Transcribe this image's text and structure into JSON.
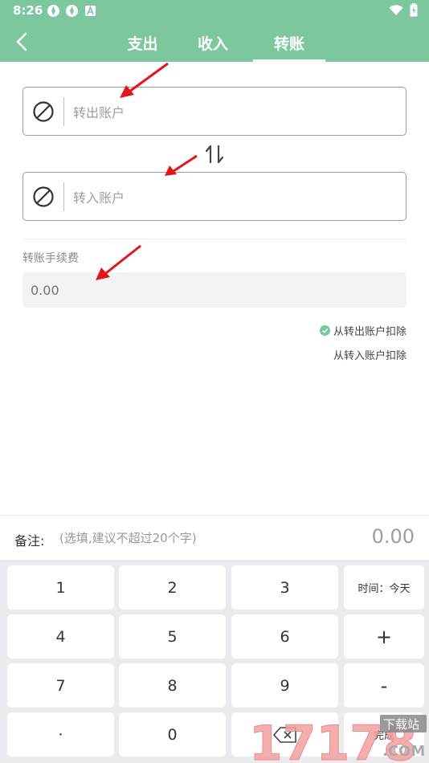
{
  "status": {
    "time": "8:26"
  },
  "header": {
    "tabs": [
      {
        "label": "支出"
      },
      {
        "label": "收入"
      },
      {
        "label": "转账",
        "active": true
      }
    ]
  },
  "transfer": {
    "out_placeholder": "转出账户",
    "in_placeholder": "转入账户",
    "fee_label": "转账手续费",
    "fee_placeholder": "0.00",
    "deduct_options": [
      {
        "label": "从转出账户扣除",
        "selected": true
      },
      {
        "label": "从转入账户扣除",
        "selected": false
      }
    ]
  },
  "note": {
    "label": "备注:",
    "placeholder": "(选填,建议不超过20个字)",
    "amount": "0.00"
  },
  "keypad": {
    "keys": [
      "1",
      "2",
      "3",
      "时间：今天",
      "4",
      "5",
      "6",
      "+",
      "7",
      "8",
      "9",
      "-",
      "·",
      "0",
      "backspace-icon",
      "完成"
    ]
  },
  "watermark": {
    "text": "17178",
    "sub": "下载站",
    "domain": ".COM"
  },
  "colors": {
    "header": "#7cc79e",
    "check": "#7cc79e",
    "arrow": "#e0161b"
  }
}
